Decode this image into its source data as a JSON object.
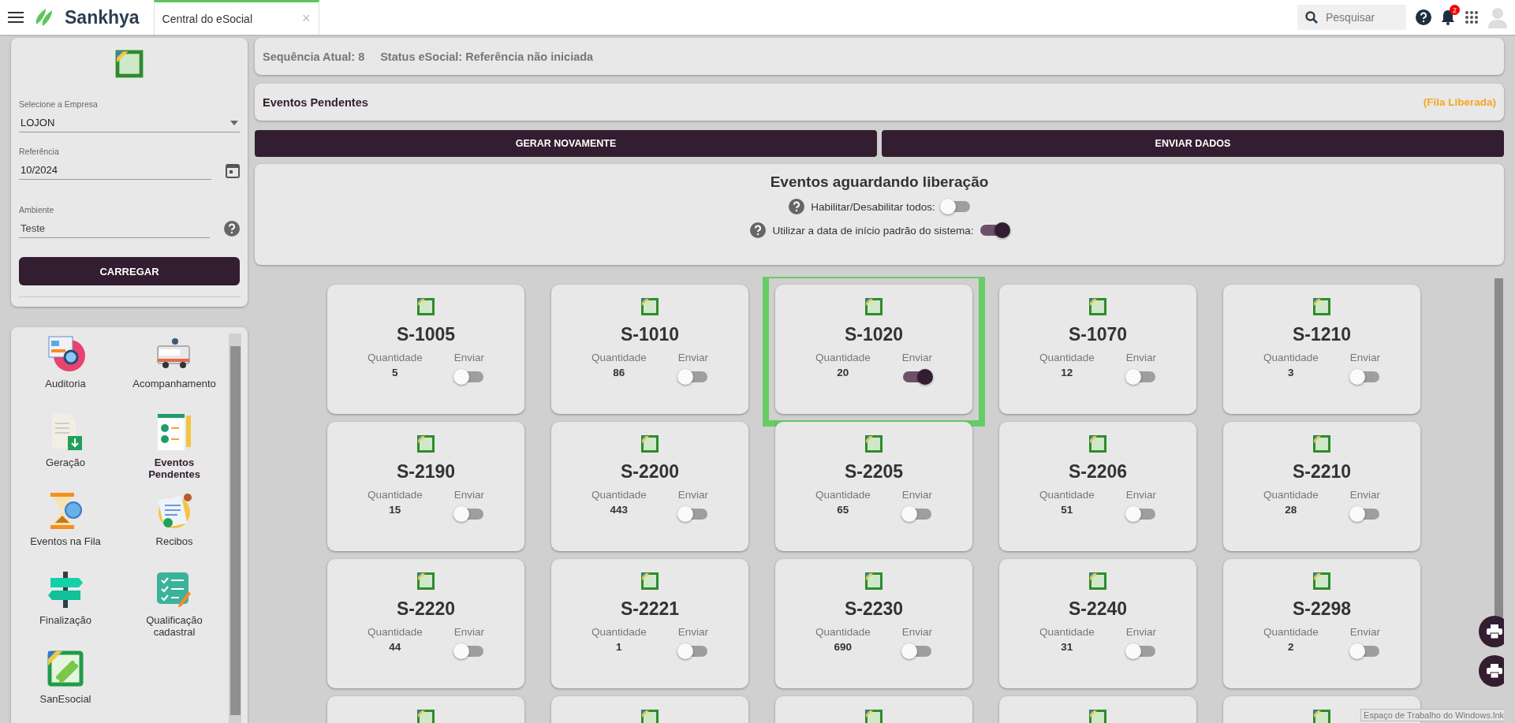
{
  "topbar": {
    "brand": "Sankhya",
    "tab": {
      "label": "Central do eSocial",
      "close": "×",
      "selected": true
    },
    "search": {
      "placeholder": "Pesquisar"
    },
    "notifications": "2"
  },
  "form": {
    "company": {
      "label": "Selecione a Empresa",
      "value": "LOJON"
    },
    "reference": {
      "label": "Referência",
      "value": "10/2024"
    },
    "environment": {
      "label": "Ambiente",
      "value": "Teste"
    },
    "load_button": "CARREGAR"
  },
  "nav": [
    {
      "label": "Auditoria",
      "kind": "audit",
      "selected": false
    },
    {
      "label": "Acompanhamento",
      "kind": "news",
      "selected": false
    },
    {
      "label": "Geração",
      "kind": "download",
      "selected": false
    },
    {
      "label": "Eventos Pendentes",
      "kind": "checklist",
      "selected": true
    },
    {
      "label": "Eventos na Fila",
      "kind": "hourglass",
      "selected": false
    },
    {
      "label": "Recibos",
      "kind": "receipt",
      "selected": false
    },
    {
      "label": "Finalização",
      "kind": "signpost",
      "selected": false
    },
    {
      "label": "Qualificação cadastral",
      "kind": "tasks",
      "selected": false
    },
    {
      "label": "SanEsocial",
      "kind": "logo",
      "selected": false
    }
  ],
  "status": {
    "sequence": "Sequência Atual: 8",
    "status": "Status eSocial: Referência não iniciada"
  },
  "pending": {
    "title": "Eventos Pendentes",
    "queue": "(Fila Liberada)"
  },
  "actions": [
    "GERAR NOVAMENTE",
    "ENVIAR DADOS"
  ],
  "waiting": {
    "title": "Eventos aguardando liberação",
    "toggles": [
      {
        "label": "Habilitar/Desabilitar todos:",
        "on": false
      },
      {
        "label": "Utilizar a data de início padrão do sistema:",
        "on": true
      }
    ]
  },
  "events": [
    {
      "kind": "full",
      "code": "S-1005",
      "qty_label": "Quantidade",
      "quantity": "5",
      "send_label": "Enviar",
      "on": false,
      "selected": false
    },
    {
      "kind": "full",
      "code": "S-1010",
      "qty_label": "Quantidade",
      "quantity": "86",
      "send_label": "Enviar",
      "on": false,
      "selected": false
    },
    {
      "kind": "full",
      "code": "S-1020",
      "qty_label": "Quantidade",
      "quantity": "20",
      "send_label": "Enviar",
      "on": true,
      "selected": true
    },
    {
      "kind": "full",
      "code": "S-1070",
      "qty_label": "Quantidade",
      "quantity": "12",
      "send_label": "Enviar",
      "on": false,
      "selected": false
    },
    {
      "kind": "full",
      "code": "S-1210",
      "qty_label": "Quantidade",
      "quantity": "3",
      "send_label": "Enviar",
      "on": false,
      "selected": false
    },
    {
      "kind": "full",
      "code": "S-2190",
      "qty_label": "Quantidade",
      "quantity": "15",
      "send_label": "Enviar",
      "on": false,
      "selected": false
    },
    {
      "kind": "full",
      "code": "S-2200",
      "qty_label": "Quantidade",
      "quantity": "443",
      "send_label": "Enviar",
      "on": false,
      "selected": false
    },
    {
      "kind": "full",
      "code": "S-2205",
      "qty_label": "Quantidade",
      "quantity": "65",
      "send_label": "Enviar",
      "on": false,
      "selected": false
    },
    {
      "kind": "full",
      "code": "S-2206",
      "qty_label": "Quantidade",
      "quantity": "51",
      "send_label": "Enviar",
      "on": false,
      "selected": false
    },
    {
      "kind": "full",
      "code": "S-2210",
      "qty_label": "Quantidade",
      "quantity": "28",
      "send_label": "Enviar",
      "on": false,
      "selected": false
    },
    {
      "kind": "full",
      "code": "S-2220",
      "qty_label": "Quantidade",
      "quantity": "44",
      "send_label": "Enviar",
      "on": false,
      "selected": false
    },
    {
      "kind": "full",
      "code": "S-2221",
      "qty_label": "Quantidade",
      "quantity": "1",
      "send_label": "Enviar",
      "on": false,
      "selected": false
    },
    {
      "kind": "full",
      "code": "S-2230",
      "qty_label": "Quantidade",
      "quantity": "690",
      "send_label": "Enviar",
      "on": false,
      "selected": false
    },
    {
      "kind": "full",
      "code": "S-2240",
      "qty_label": "Quantidade",
      "quantity": "31",
      "send_label": "Enviar",
      "on": false,
      "selected": false
    },
    {
      "kind": "full",
      "code": "S-2298",
      "qty_label": "Quantidade",
      "quantity": "2",
      "send_label": "Enviar",
      "on": false,
      "selected": false
    },
    {
      "kind": "partial"
    },
    {
      "kind": "partial"
    },
    {
      "kind": "partial"
    },
    {
      "kind": "partial"
    },
    {
      "kind": "partial"
    }
  ],
  "tooltip": "Espaço de Trabalho do Windows.lnk"
}
